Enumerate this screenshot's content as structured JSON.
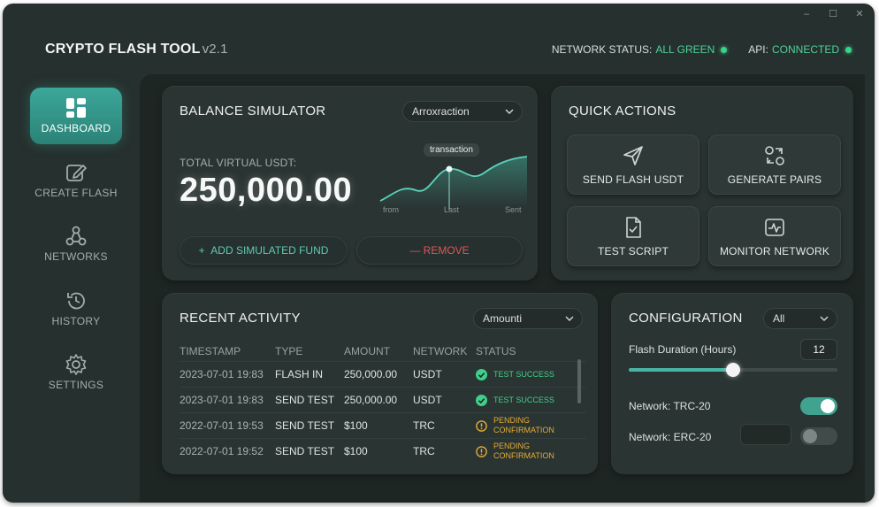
{
  "window": {
    "controls": [
      "–",
      "☐",
      "✕"
    ]
  },
  "header": {
    "title": "CRYPTO FLASH TOOL",
    "version": "v2.1",
    "network_status_label": "NETWORK STATUS:",
    "network_status_value": "ALL GREEN",
    "api_label": "API:",
    "api_value": "CONNECTED"
  },
  "sidebar": {
    "items": [
      {
        "label": "DASHBOARD",
        "icon": "dashboard-icon",
        "active": true
      },
      {
        "label": "CREATE FLASH",
        "icon": "edit-icon",
        "active": false
      },
      {
        "label": "NETWORKS",
        "icon": "network-icon",
        "active": false
      },
      {
        "label": "HISTORY",
        "icon": "history-icon",
        "active": false
      },
      {
        "label": "SETTINGS",
        "icon": "gear-icon",
        "active": false
      }
    ]
  },
  "balance": {
    "title": "BALANCE SIMULATOR",
    "dropdown_value": "Arroxraction",
    "total_label": "TOTAL VIRTUAL USDT:",
    "total_value": "250,000.00",
    "chart_tooltip": "transaction",
    "chart_ticks": [
      "from",
      "Last",
      "Sent"
    ],
    "add_button": "ADD SIMULATED FUND",
    "remove_button": "REMOVE"
  },
  "quick_actions": {
    "title": "QUICK ACTIONS",
    "buttons": [
      {
        "label": "SEND FLASH USDT",
        "icon": "send-icon"
      },
      {
        "label": "GENERATE PAIRS",
        "icon": "pairs-icon"
      },
      {
        "label": "TEST SCRIPT",
        "icon": "script-icon"
      },
      {
        "label": "MONITOR NETWORK",
        "icon": "monitor-icon"
      }
    ]
  },
  "activity": {
    "title": "RECENT ACTIVITY",
    "dropdown_value": "Amounti",
    "columns": [
      "TIMESTAMP",
      "TYPE",
      "AMOUNT",
      "NETWORK",
      "STATUS"
    ],
    "rows": [
      {
        "timestamp": "2023-07-01 19:83",
        "type": "FLASH IN",
        "amount": "250,000.00",
        "network": "USDT",
        "status_l1": "TEST SUCCESS",
        "status_l2": ""
      },
      {
        "timestamp": "2023-07-01 19:83",
        "type": "SEND TEST",
        "amount": "250,000.00",
        "network": "USDT",
        "status_l1": "TEST SUCCESS",
        "status_l2": ""
      },
      {
        "timestamp": "2022-07-01 19:53",
        "type": "SEND TEST",
        "amount": "$100",
        "network": "TRC",
        "status_l1": "PENDING",
        "status_l2": "CONFIRMATION"
      },
      {
        "timestamp": "2022-07-01 19:52",
        "type": "SEND TEST",
        "amount": "$100",
        "network": "TRC",
        "status_l1": "PENDING",
        "status_l2": "CONFIRMATION"
      }
    ]
  },
  "config": {
    "title": "CONFIGURATION",
    "dropdown_value": "All",
    "duration_label": "Flash Duration (Hours)",
    "duration_value": "12",
    "slider_fraction": 0.5,
    "trc_label": "Network: TRC-20",
    "trc_on": true,
    "erc_label": "Network: ERC-20",
    "erc_on": false
  },
  "colors": {
    "accent": "#3fa38f",
    "success": "#3fcf8a",
    "pending": "#e5ab35",
    "danger": "#e0555a"
  }
}
